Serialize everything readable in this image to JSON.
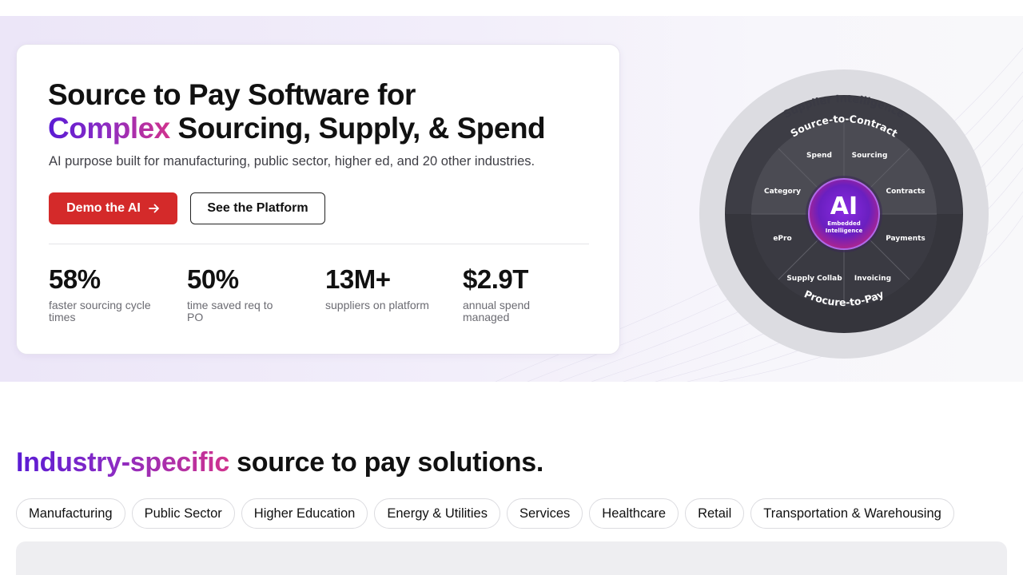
{
  "hero": {
    "title_line1": "Source to Pay Software for",
    "title_highlight": "Complex",
    "title_line2_rest": " Sourcing, Supply, & Spend",
    "subtitle": "AI purpose built for manufacturing, public sector, higher ed, and 20 other industries.",
    "demo_button": "Demo the AI",
    "platform_button": "See the Platform",
    "stats": [
      {
        "value": "58%",
        "label": "faster sourcing cycle times"
      },
      {
        "value": "50%",
        "label": "time saved req to PO"
      },
      {
        "value": "13M+",
        "label": "suppliers on platform"
      },
      {
        "value": "$2.9T",
        "label": "annual spend managed"
      }
    ]
  },
  "wheel": {
    "outer_label": "Supplier Intelligence",
    "top_label": "Source-to-Contract",
    "bottom_label": "Procure-to-Pay",
    "center_title": "AI",
    "center_sub1": "Embedded",
    "center_sub2": "Intelligence",
    "segments": {
      "spend": "Spend",
      "sourcing": "Sourcing",
      "category": "Category",
      "contracts": "Contracts",
      "epro": "ePro",
      "payments": "Payments",
      "supply_collab": "Supply Collab",
      "invoicing": "Invoicing"
    }
  },
  "industries": {
    "title_highlight": "Industry-specific",
    "title_rest": " source to pay solutions.",
    "chips": [
      "Manufacturing",
      "Public Sector",
      "Higher Education",
      "Energy & Utilities",
      "Services",
      "Healthcare",
      "Retail",
      "Transportation & Warehousing"
    ]
  },
  "colors": {
    "accent_red": "#d42a2a",
    "gradient_start": "#5a1bd4",
    "gradient_end": "#d1338d"
  }
}
